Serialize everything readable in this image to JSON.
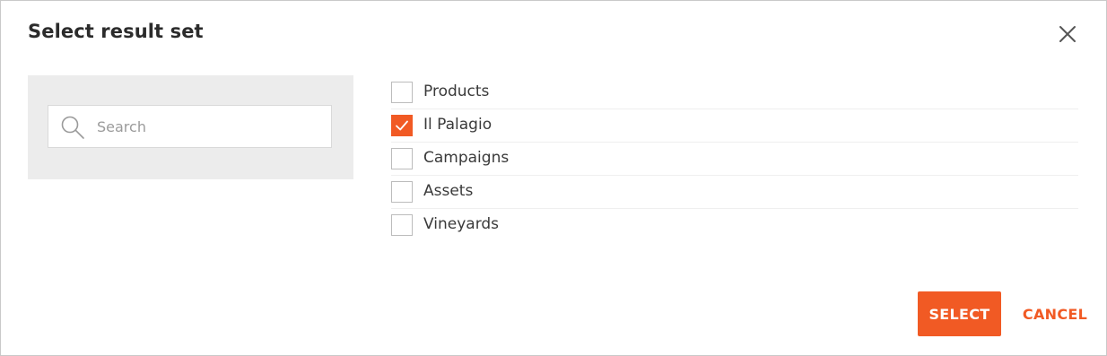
{
  "dialog": {
    "title": "Select result set"
  },
  "search": {
    "placeholder": "Search",
    "value": ""
  },
  "result_sets": [
    {
      "label": "Products",
      "checked": false
    },
    {
      "label": "Il Palagio",
      "checked": true
    },
    {
      "label": "Campaigns",
      "checked": false
    },
    {
      "label": "Assets",
      "checked": false
    },
    {
      "label": "Vineyards",
      "checked": false
    }
  ],
  "actions": {
    "select_label": "SELECT",
    "cancel_label": "CANCEL"
  },
  "colors": {
    "accent": "#f15a24",
    "panel": "#ececec"
  },
  "icons": {
    "close": "close-icon",
    "search": "search-icon",
    "check": "checkmark-icon"
  }
}
